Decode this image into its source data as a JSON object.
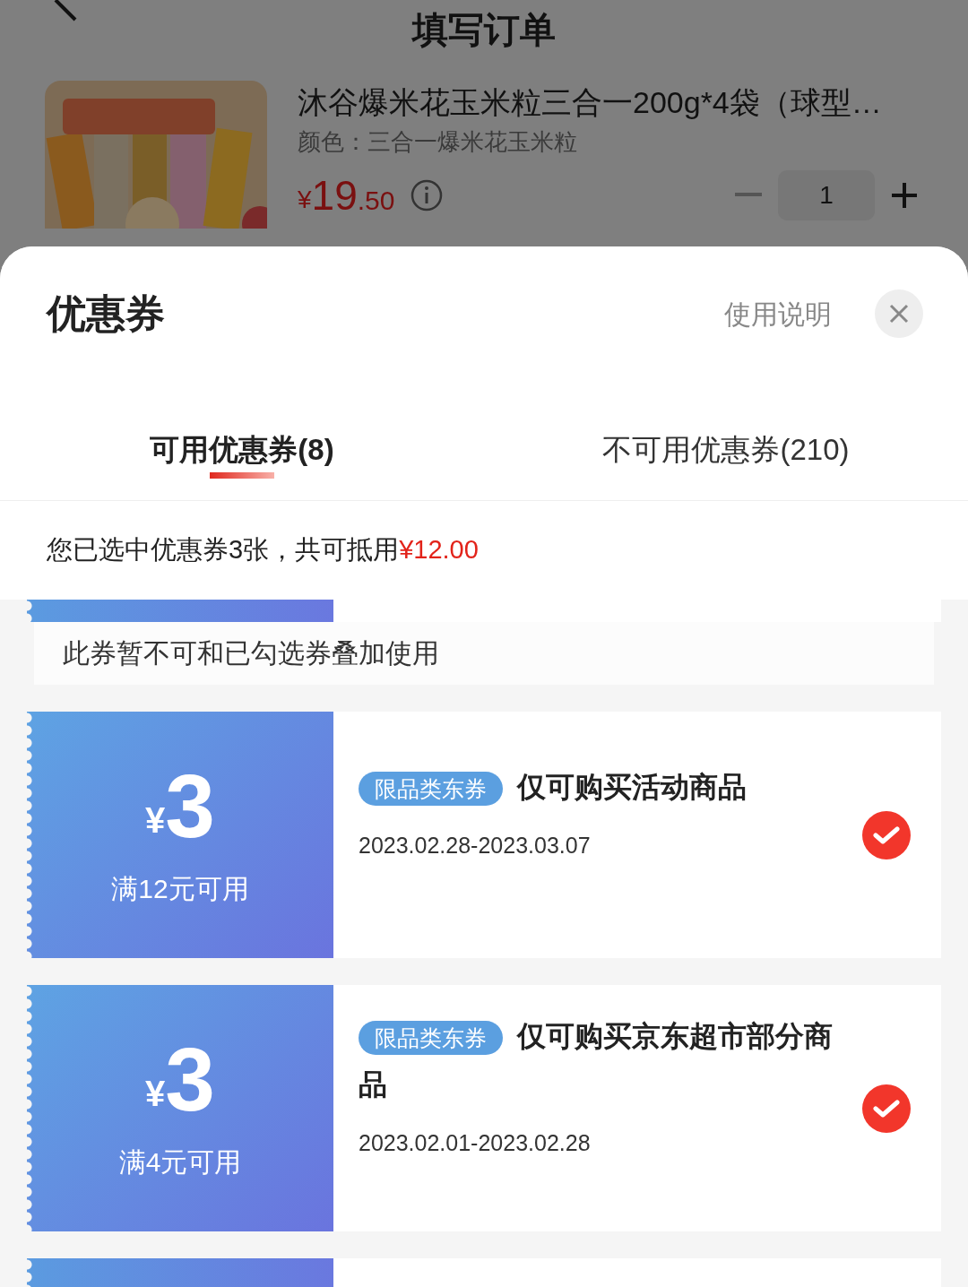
{
  "page": {
    "title": "填写订单"
  },
  "product": {
    "name": "沐谷爆米花玉米粒三合一200g*4袋（球型…",
    "spec": "颜色：三合一爆米花玉米粒",
    "currency": "¥",
    "price_int": "19",
    "price_dec": ".50",
    "quantity": "1"
  },
  "sheet": {
    "title": "优惠券",
    "help": "使用说明"
  },
  "tabs": [
    {
      "label": "可用优惠券(8)",
      "selected": true
    },
    {
      "label": "不可用优惠券(210)",
      "selected": false
    }
  ],
  "summary": {
    "text": "您已选中优惠券3张，共可抵用",
    "amount": "¥12.00"
  },
  "notice": "此券暂不可和已勾选券叠加使用",
  "coupons": [
    {
      "currency": "¥",
      "amount": "3",
      "condition": "满12元可用",
      "tag": "限品类东券",
      "title": "仅可购买活动商品",
      "dates": "2023.02.28-2023.03.07",
      "checked": true
    },
    {
      "currency": "¥",
      "amount": "3",
      "condition": "满4元可用",
      "tag": "限品类东券",
      "title": "仅可购买京东超市部分商品",
      "dates": "2023.02.01-2023.02.28",
      "checked": true
    }
  ]
}
